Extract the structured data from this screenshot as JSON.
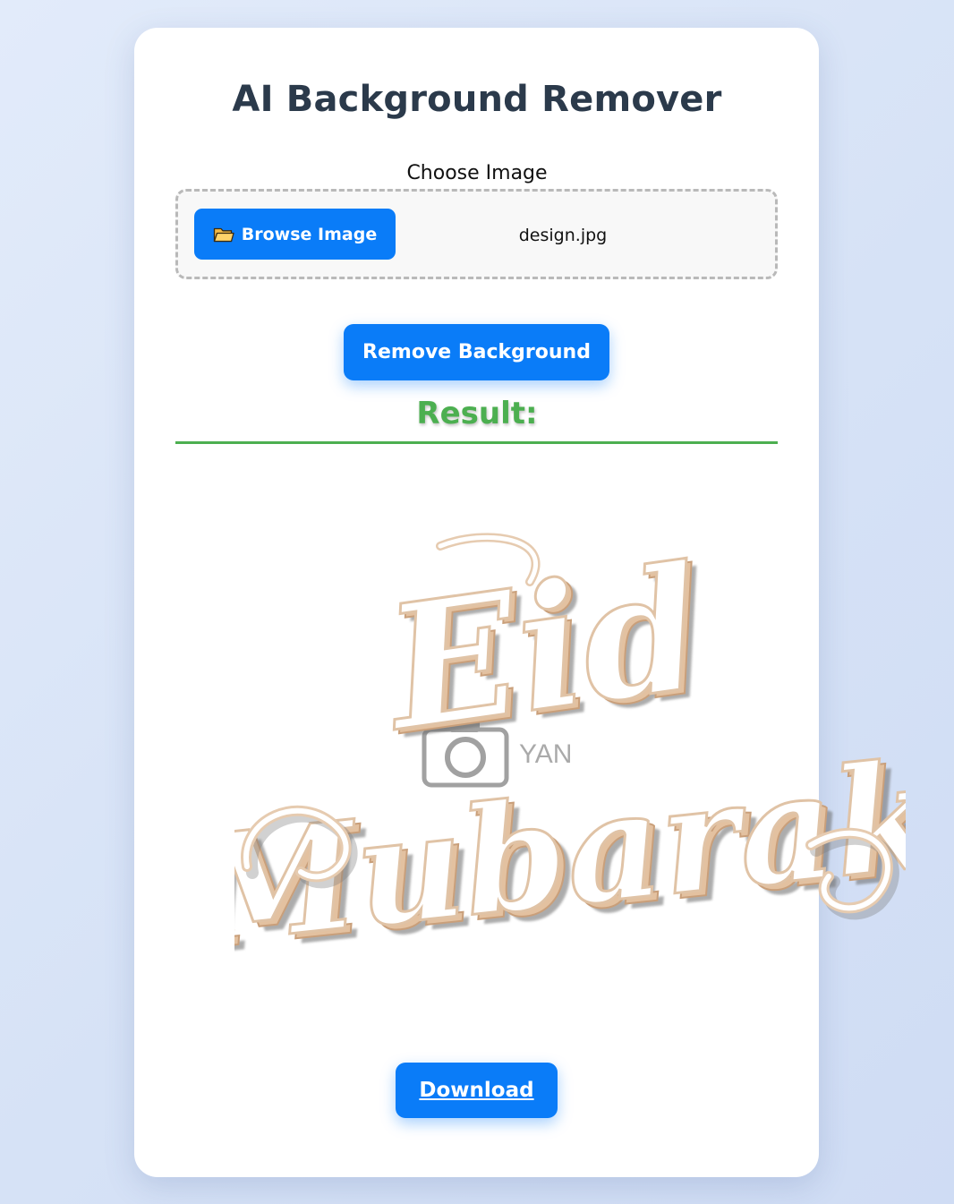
{
  "header": {
    "title": "AI Background Remover"
  },
  "upload": {
    "label": "Choose Image",
    "browse_label": "Browse Image",
    "browse_icon": "folder-icon",
    "file_name": "design.jpg"
  },
  "actions": {
    "remove_label": "Remove Background",
    "download_label": "Download"
  },
  "result": {
    "heading": "Result:",
    "image_text_line1": "Eid",
    "image_text_line2": "Mubarak",
    "watermark_text": "YAN"
  },
  "colors": {
    "accent": "#0a7cf8",
    "result_green": "#4caf50",
    "title": "#2b3a4b",
    "background": "#dce6f7"
  }
}
